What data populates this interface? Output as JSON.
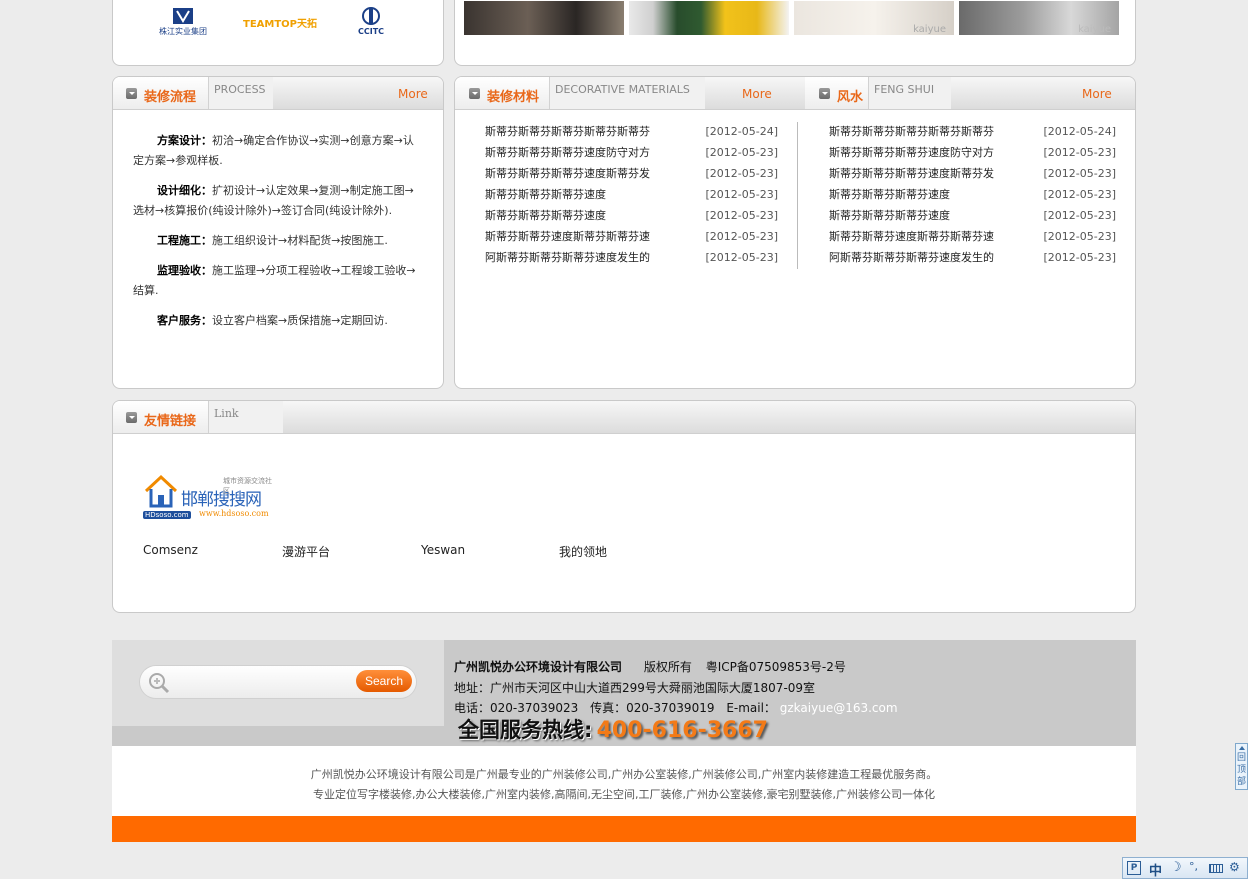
{
  "partners": [
    {
      "name": "株江实业集团"
    },
    {
      "name": "TEAMTOP天拓"
    },
    {
      "name": "CCITC"
    }
  ],
  "gallery": {
    "watermarks": [
      "kaiyue",
      "kaiyue"
    ]
  },
  "process": {
    "title_cn": "装修流程",
    "title_en": "PROCESS",
    "more": "More",
    "steps": [
      {
        "label": "方案设计：",
        "text": "初洽→确定合作协议→实测→创意方案→认定方案→参观样板."
      },
      {
        "label": "设计细化：",
        "text": "扩初设计→认定效果→复测→制定施工图→选材→核算报价(纯设计除外)→签订合同(纯设计除外)."
      },
      {
        "label": "工程施工：",
        "text": "施工组织设计→材料配货→按图施工."
      },
      {
        "label": "监理验收：",
        "text": "施工监理→分项工程验收→工程竣工验收→结算."
      },
      {
        "label": "客户服务：",
        "text": "设立客户档案→质保措施→定期回访."
      }
    ]
  },
  "materials": {
    "title_cn": "装修材料",
    "title_en": "DECORATIVE MATERIALS",
    "more": "More",
    "items": [
      {
        "title": "斯蒂芬斯蒂芬斯蒂芬斯蒂芬斯蒂芬",
        "date": "[2012-05-24]"
      },
      {
        "title": "斯蒂芬斯蒂芬斯蒂芬速度防守对方",
        "date": "[2012-05-23]"
      },
      {
        "title": "斯蒂芬斯蒂芬斯蒂芬速度斯蒂芬发",
        "date": "[2012-05-23]"
      },
      {
        "title": "斯蒂芬斯蒂芬斯蒂芬速度",
        "date": "[2012-05-23]"
      },
      {
        "title": "斯蒂芬斯蒂芬斯蒂芬速度",
        "date": "[2012-05-23]"
      },
      {
        "title": "斯蒂芬斯蒂芬速度斯蒂芬斯蒂芬速",
        "date": "[2012-05-23]"
      },
      {
        "title": "阿斯蒂芬斯蒂芬斯蒂芬速度发生的",
        "date": "[2012-05-23]"
      }
    ]
  },
  "fengshui": {
    "title_cn": "风水",
    "title_en": "FENG SHUI",
    "more": "More",
    "items": [
      {
        "title": "斯蒂芬斯蒂芬斯蒂芬斯蒂芬斯蒂芬",
        "date": "[2012-05-24]"
      },
      {
        "title": "斯蒂芬斯蒂芬斯蒂芬速度防守对方",
        "date": "[2012-05-23]"
      },
      {
        "title": "斯蒂芬斯蒂芬斯蒂芬速度斯蒂芬发",
        "date": "[2012-05-23]"
      },
      {
        "title": "斯蒂芬斯蒂芬斯蒂芬速度",
        "date": "[2012-05-23]"
      },
      {
        "title": "斯蒂芬斯蒂芬斯蒂芬速度",
        "date": "[2012-05-23]"
      },
      {
        "title": "斯蒂芬斯蒂芬速度斯蒂芬斯蒂芬速",
        "date": "[2012-05-23]"
      },
      {
        "title": "阿斯蒂芬斯蒂芬斯蒂芬速度发生的",
        "date": "[2012-05-23]"
      }
    ]
  },
  "links": {
    "title_cn": "友情链接",
    "title_en": "Link",
    "logo": {
      "name": "邯郸搜搜网",
      "tagline": "城市资源交流社区",
      "domain": "www.hdsoso.com",
      "badge": "HDsoso.com"
    },
    "items": [
      "Comsenz",
      "漫游平台",
      "Yeswan",
      "我的领地"
    ]
  },
  "search": {
    "button": "Search",
    "placeholder": ""
  },
  "footer": {
    "company": "广州凯悦办公环境设计有限公司",
    "rights": "版权所有",
    "icp": "粤ICP备07509853号-2号",
    "address": "地址：广州市天河区中山大道西299号大舜丽池国际大厦1807-09室",
    "phone": "电话：020-37039023",
    "fax": "传真：020-37039019",
    "email_label": "E-mail：",
    "email": "gzkaiyue@163.com",
    "hotline_label": "全国服务热线:",
    "hotline_number": "400-616-3667",
    "desc1": "广州凯悦办公环境设计有限公司是广州最专业的广州装修公司,广州办公室装修,广州装修公司,广州室内装修建造工程最优服务商。",
    "desc2": "专业定位写字楼装修,办公大楼装修,广州室内装修,高隔间,无尘空间,工厂装修,广州办公室装修,豪宅别墅装修,广州装修公司一体化"
  },
  "back_to_top": "回顶部",
  "ime": {
    "label": "中"
  },
  "colors": {
    "accent": "#e9681a",
    "footer_bar": "#ff6a00",
    "hotline": "#f37a17"
  }
}
